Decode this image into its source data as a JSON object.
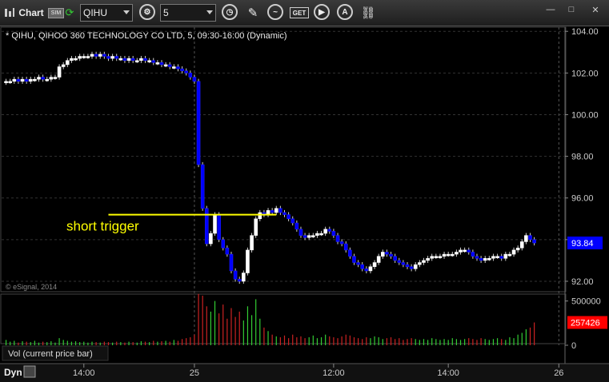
{
  "toolbar": {
    "app_label": "Chart",
    "sim_badge": "SIM",
    "symbol_value": "QIHU",
    "interval_value": "5",
    "icons": [
      "chart-icon",
      "sim-icon",
      "refresh-icon",
      "gear-icon",
      "clock-icon",
      "pencil-icon",
      "draw-tool-icon",
      "get-icon",
      "play-icon",
      "alert-icon",
      "link-icon"
    ]
  },
  "window": {
    "minimize": "—",
    "maximize": "□",
    "close": "✕"
  },
  "chart_data": {
    "type": "candlestick",
    "title": "* QIHU, QIHOO 360 TECHNOLOGY CO LTD, 5, 09:30-16:00 (Dynamic)",
    "watermark": "© eSignal, 2014",
    "price_axis": {
      "ticks": [
        "104.00",
        "102.00",
        "100.00",
        "98.00",
        "96.00",
        "94.00",
        "92.00"
      ],
      "ylim": [
        91.5,
        104.2
      ]
    },
    "last_price": "93.84",
    "last_price_color": "#0000ff",
    "annotation": {
      "text": "short trigger",
      "price": 95.2,
      "color": "#ffff00"
    },
    "x_axis": {
      "ticks": [
        {
          "label": "14:00",
          "bar": 19
        },
        {
          "label": "25",
          "bar": 46
        },
        {
          "label": "12:00",
          "bar": 80
        },
        {
          "label": "14:00",
          "bar": 108
        },
        {
          "label": "26",
          "bar": 135
        }
      ],
      "bars_total": 137
    },
    "day_separators": [
      46,
      135
    ],
    "prices_close": [
      101.6,
      101.6,
      101.7,
      101.6,
      101.7,
      101.6,
      101.7,
      101.7,
      101.8,
      101.7,
      101.7,
      101.8,
      101.8,
      102.3,
      102.4,
      102.6,
      102.7,
      102.7,
      102.8,
      102.8,
      102.8,
      102.9,
      102.8,
      102.9,
      102.8,
      102.7,
      102.8,
      102.7,
      102.7,
      102.6,
      102.7,
      102.6,
      102.6,
      102.7,
      102.6,
      102.6,
      102.5,
      102.5,
      102.4,
      102.4,
      102.3,
      102.3,
      102.2,
      102.1,
      102.0,
      101.8,
      101.6,
      97.6,
      95.5,
      93.8,
      94.3,
      95.2,
      94.0,
      93.6,
      93.3,
      92.5,
      92.1,
      92.0,
      92.4,
      93.5,
      94.2,
      95.0,
      95.3,
      95.2,
      95.4,
      95.3,
      95.5,
      95.3,
      95.2,
      95.0,
      94.8,
      94.5,
      94.2,
      94.1,
      94.2,
      94.2,
      94.3,
      94.3,
      94.5,
      94.4,
      94.2,
      93.9,
      93.8,
      93.5,
      93.2,
      92.9,
      92.8,
      92.6,
      92.5,
      92.7,
      92.9,
      93.2,
      93.4,
      93.3,
      93.2,
      93.0,
      92.9,
      92.8,
      92.7,
      92.6,
      92.8,
      92.9,
      93.0,
      93.1,
      93.2,
      93.2,
      93.2,
      93.3,
      93.3,
      93.3,
      93.4,
      93.5,
      93.5,
      93.4,
      93.2,
      93.1,
      93.0,
      93.1,
      93.1,
      93.2,
      93.2,
      93.1,
      93.3,
      93.3,
      93.5,
      93.6,
      93.9,
      94.2,
      94.0,
      93.84
    ],
    "volume": {
      "label": "Vol (current price bar)",
      "ticks": [
        "500000",
        "0"
      ],
      "ylim": [
        0,
        560000
      ],
      "last_value": "257426",
      "last_value_color": "#ff0000",
      "values": [
        60000,
        40000,
        50000,
        30000,
        45000,
        40000,
        35000,
        50000,
        30000,
        40000,
        35000,
        45000,
        30000,
        80000,
        60000,
        50000,
        40000,
        45000,
        35000,
        40000,
        30000,
        40000,
        35000,
        30000,
        40000,
        35000,
        30000,
        40000,
        35000,
        30000,
        40000,
        35000,
        30000,
        45000,
        40000,
        35000,
        50000,
        40000,
        45000,
        50000,
        40000,
        60000,
        50000,
        70000,
        80000,
        90000,
        120000,
        580000,
        560000,
        440000,
        380000,
        500000,
        360000,
        460000,
        300000,
        420000,
        320000,
        380000,
        280000,
        440000,
        340000,
        520000,
        300000,
        200000,
        160000,
        120000,
        100000,
        90000,
        110000,
        80000,
        120000,
        90000,
        100000,
        80000,
        90000,
        110000,
        80000,
        90000,
        120000,
        100000,
        90000,
        80000,
        100000,
        120000,
        110000,
        90000,
        80000,
        70000,
        90000,
        80000,
        100000,
        90000,
        70000,
        80000,
        90000,
        70000,
        80000,
        60000,
        70000,
        80000,
        70000,
        60000,
        70000,
        60000,
        80000,
        70000,
        60000,
        70000,
        60000,
        80000,
        70000,
        60000,
        70000,
        80000,
        70000,
        60000,
        80000,
        70000,
        60000,
        70000,
        80000,
        70000,
        60000,
        90000,
        80000,
        120000,
        140000,
        180000,
        200000,
        257426
      ]
    }
  }
}
